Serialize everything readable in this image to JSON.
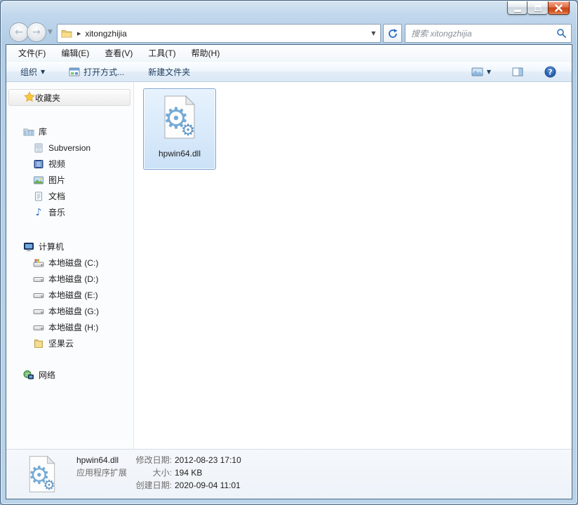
{
  "navbar": {
    "address": {
      "path_item": "xitongzhijia"
    },
    "search_placeholder": "搜索 xitongzhijia"
  },
  "menubar": {
    "items": [
      "文件(F)",
      "编辑(E)",
      "查看(V)",
      "工具(T)",
      "帮助(H)"
    ]
  },
  "toolbar": {
    "organize_label": "组织",
    "open_with_label": "打开方式...",
    "new_folder_label": "新建文件夹"
  },
  "sidebar": {
    "items": [
      {
        "label": "收藏夹",
        "icon": "star"
      },
      {
        "label": "库",
        "icon": "libraries"
      },
      {
        "label": "Subversion",
        "icon": "library"
      },
      {
        "label": "视频",
        "icon": "videos"
      },
      {
        "label": "图片",
        "icon": "pictures"
      },
      {
        "label": "文档",
        "icon": "documents"
      },
      {
        "label": "音乐",
        "icon": "music"
      },
      {
        "label": "计算机",
        "icon": "computer"
      },
      {
        "label": "本地磁盘 (C:)",
        "icon": "system-drive"
      },
      {
        "label": "本地磁盘 (D:)",
        "icon": "drive"
      },
      {
        "label": "本地磁盘 (E:)",
        "icon": "drive"
      },
      {
        "label": "本地磁盘 (G:)",
        "icon": "drive"
      },
      {
        "label": "本地磁盘 (H:)",
        "icon": "drive"
      },
      {
        "label": "坚果云",
        "icon": "folder"
      },
      {
        "label": "网络",
        "icon": "network"
      }
    ]
  },
  "main": {
    "file_name": "hpwin64.dll"
  },
  "details": {
    "file_name": "hpwin64.dll",
    "file_type": "应用程序扩展",
    "modified_label": "修改日期:",
    "modified_value": "2012-08-23 17:10",
    "size_label": "大小:",
    "size_value": "194 KB",
    "created_label": "创建日期:",
    "created_value": "2020-09-04 11:01"
  },
  "colors": {
    "selection_border": "#7da2ce",
    "selection_fill": "#d7e9fa",
    "close_button": "#c74a1d",
    "glass": "#b7d1e7"
  }
}
